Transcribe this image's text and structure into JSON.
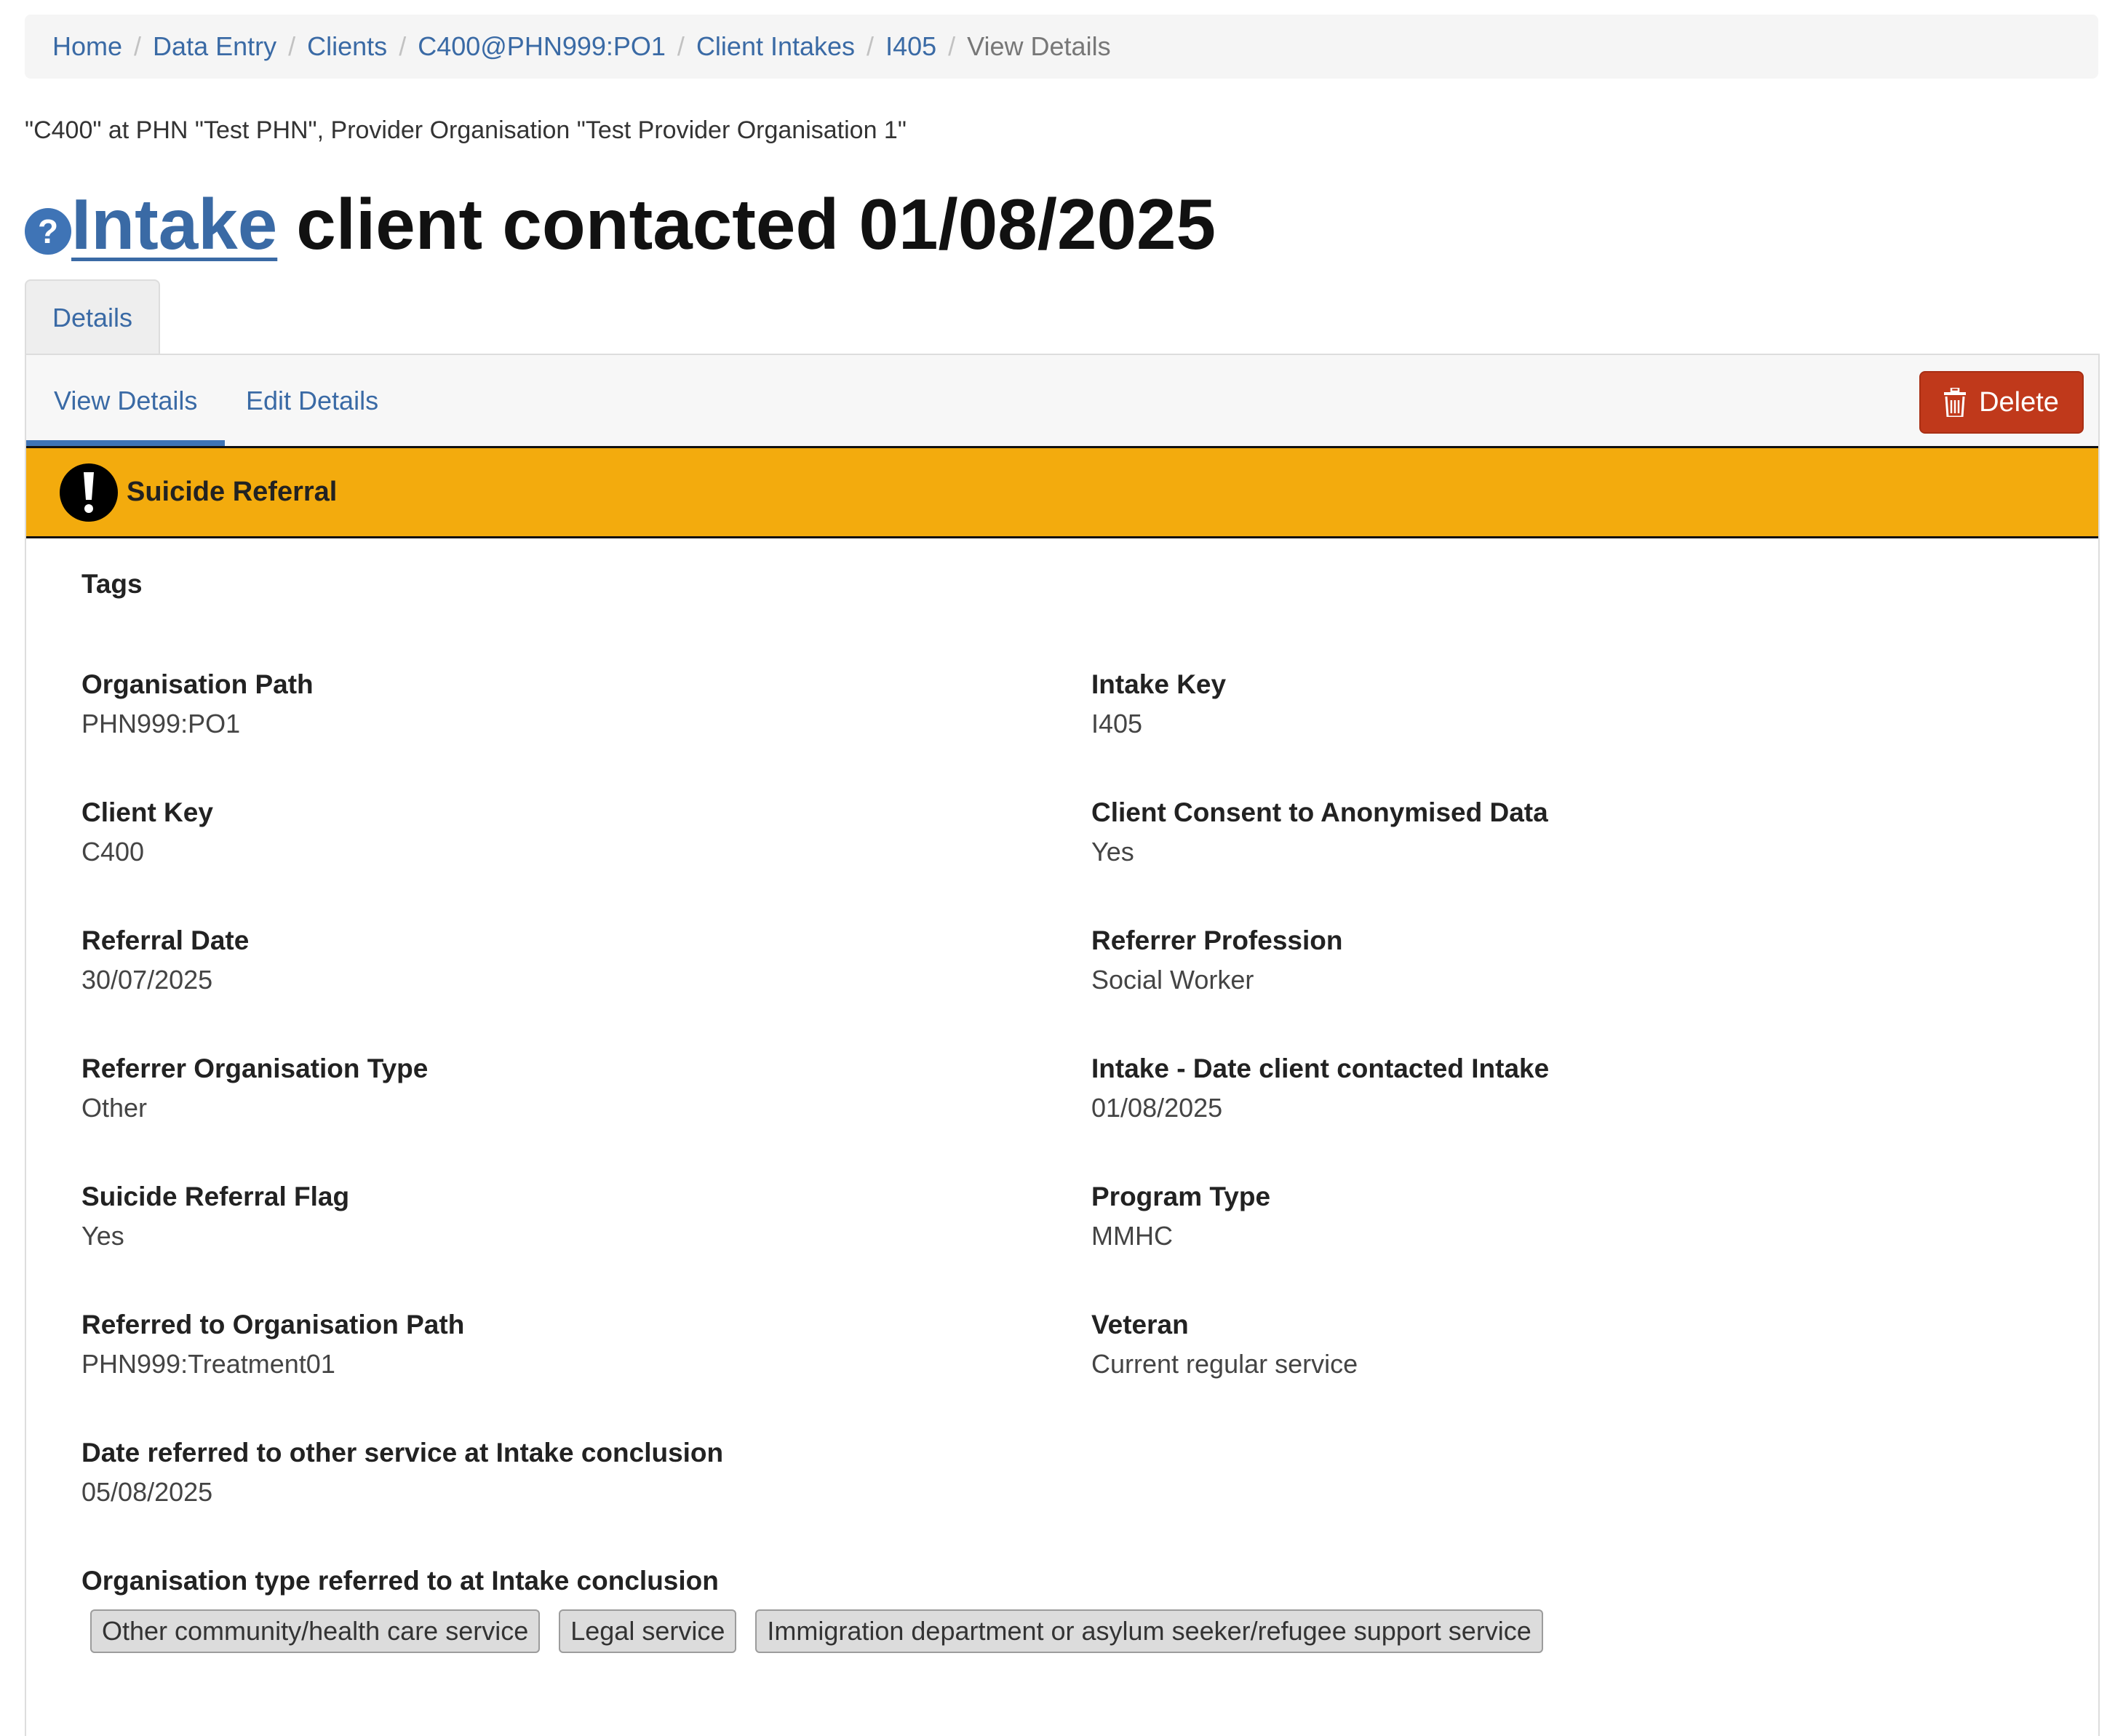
{
  "breadcrumb": {
    "items": [
      {
        "label": "Home"
      },
      {
        "label": "Data Entry"
      },
      {
        "label": "Clients"
      },
      {
        "label": "C400@PHN999:PO1"
      },
      {
        "label": "Client Intakes"
      },
      {
        "label": "I405"
      }
    ],
    "current": "View Details",
    "separator": "/"
  },
  "context_line": "\"C400\" at PHN \"Test PHN\", Provider Organisation \"Test Provider Organisation 1\"",
  "title": {
    "help_icon": "?",
    "link": "Intake",
    "rest": "client contacted 01/08/2025"
  },
  "tabs": {
    "details": "Details"
  },
  "subnav": {
    "view": "View Details",
    "edit": "Edit Details",
    "delete": "Delete",
    "delete_icon": "trash-icon"
  },
  "alert": {
    "text": "Suicide Referral",
    "icon": "exclamation-icon",
    "color": "#f3ab0d"
  },
  "fields": {
    "tags_label": "Tags",
    "org_path": {
      "label": "Organisation Path",
      "value": "PHN999:PO1"
    },
    "intake_key": {
      "label": "Intake Key",
      "value": "I405"
    },
    "client_key": {
      "label": "Client Key",
      "value": "C400"
    },
    "consent": {
      "label": "Client Consent to Anonymised Data",
      "value": "Yes"
    },
    "referral_date": {
      "label": "Referral Date",
      "value": "30/07/2025"
    },
    "referrer_profession": {
      "label": "Referrer Profession",
      "value": "Social Worker"
    },
    "referrer_org_type": {
      "label": "Referrer Organisation Type",
      "value": "Other"
    },
    "intake_date": {
      "label": "Intake - Date client contacted Intake",
      "value": "01/08/2025"
    },
    "suicide_flag": {
      "label": "Suicide Referral Flag",
      "value": "Yes"
    },
    "program_type": {
      "label": "Program Type",
      "value": "MMHC"
    },
    "referred_org_path": {
      "label": "Referred to Organisation Path",
      "value": "PHN999:Treatment01"
    },
    "veteran": {
      "label": "Veteran",
      "value": "Current regular service"
    },
    "date_referred_other": {
      "label": "Date referred to other service at Intake conclusion",
      "value": "05/08/2025"
    },
    "org_type_referred": {
      "label": "Organisation type referred to at Intake conclusion",
      "values": [
        "Other community/health care service",
        "Legal service",
        "Immigration department or asylum seeker/refugee support service"
      ]
    }
  },
  "colors": {
    "link": "#3a6aa5",
    "delete": "#c0391b",
    "alert": "#f3ab0d"
  }
}
